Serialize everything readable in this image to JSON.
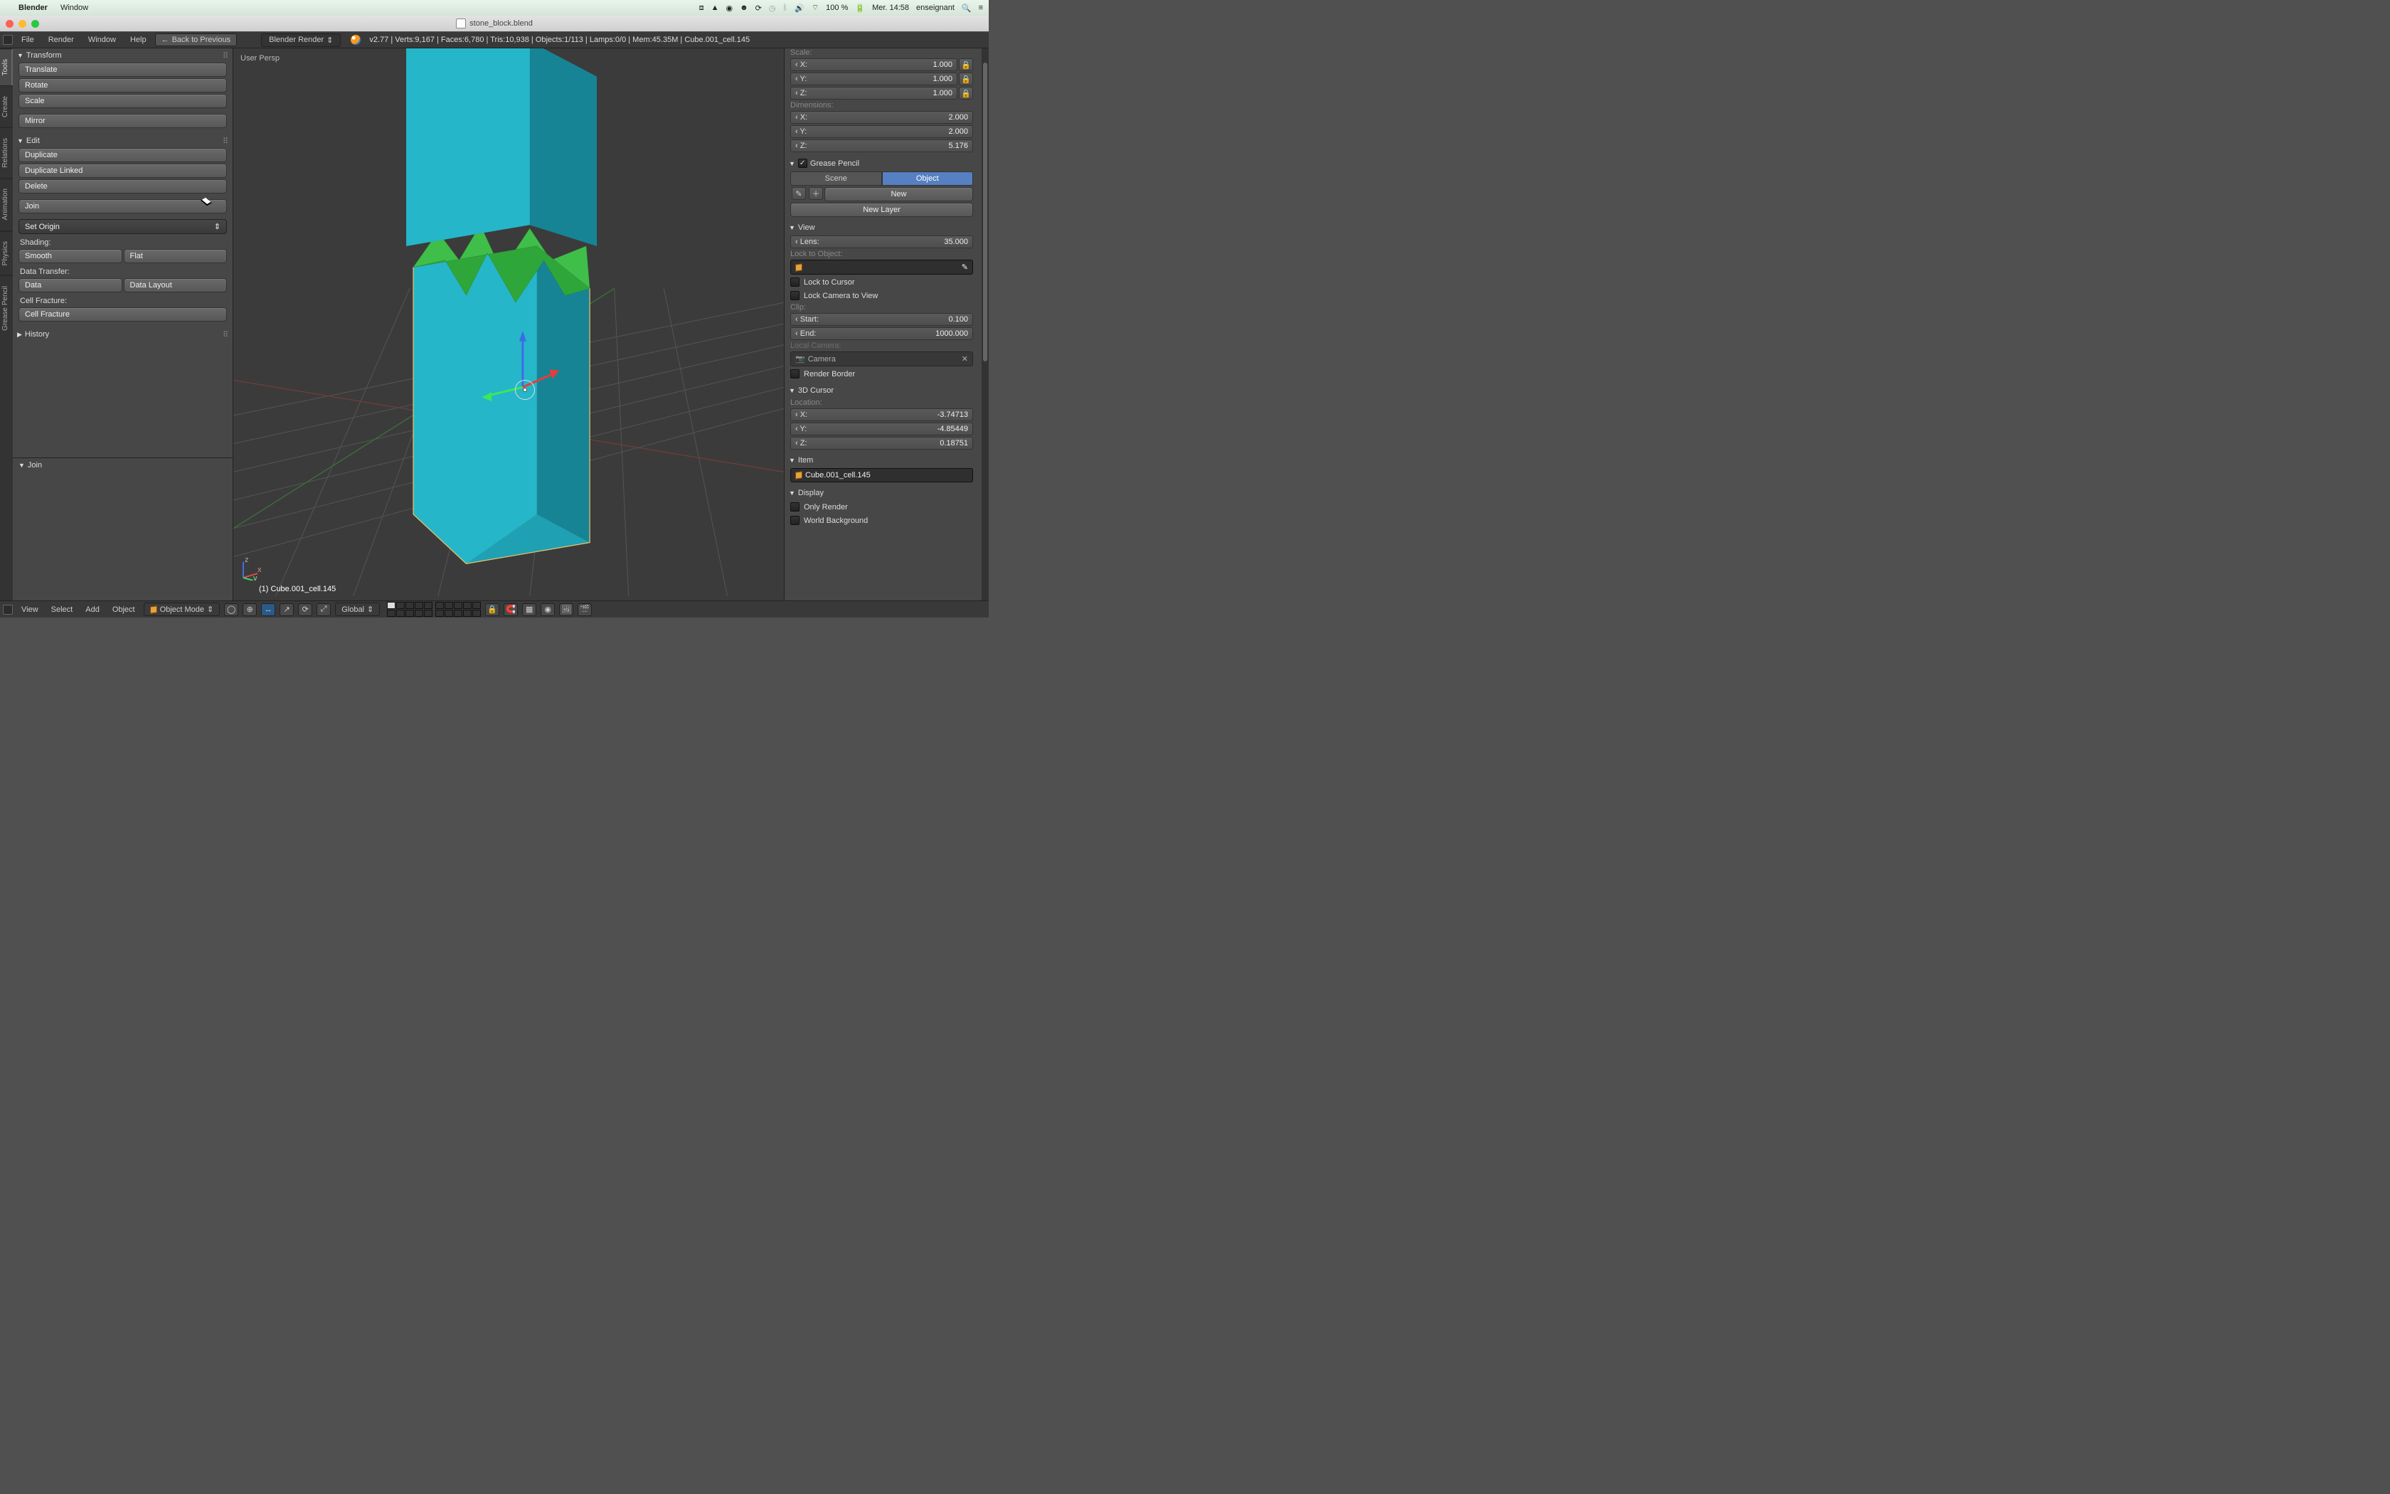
{
  "macos": {
    "app": "Blender",
    "menu_window": "Window",
    "battery": "100 %",
    "day_time": "Mer. 14:58",
    "user": "enseignant"
  },
  "window": {
    "title": "stone_block.blend"
  },
  "info": {
    "menus": {
      "file": "File",
      "render": "Render",
      "window": "Window",
      "help": "Help"
    },
    "back": "Back to Previous",
    "renderer": "Blender Render",
    "version": "v2.77",
    "stats": "Verts:9,167 | Faces:6,780 | Tris:10,938 | Objects:1/113 | Lamps:0/0 | Mem:45.35M | Cube.001_cell.145"
  },
  "vtabs": [
    "Tools",
    "Create",
    "Relations",
    "Animation",
    "Physics",
    "Grease Pencil"
  ],
  "toolshelf": {
    "transform": {
      "title": "Transform",
      "translate": "Translate",
      "rotate": "Rotate",
      "scale": "Scale",
      "mirror": "Mirror"
    },
    "edit": {
      "title": "Edit",
      "duplicate": "Duplicate",
      "duplicate_linked": "Duplicate Linked",
      "delete": "Delete",
      "join": "Join",
      "set_origin": "Set Origin"
    },
    "shading_label": "Shading:",
    "shading": {
      "smooth": "Smooth",
      "flat": "Flat"
    },
    "data_transfer_label": "Data Transfer:",
    "data_transfer": {
      "data": "Data",
      "layout": "Data Layout"
    },
    "cell_label": "Cell Fracture:",
    "cell_btn": "Cell Fracture",
    "history": "History"
  },
  "op_panel": "Join",
  "viewport": {
    "persp": "User Persp",
    "object_label": "(1) Cube.001_cell.145"
  },
  "nprops": {
    "scale_label": "Scale:",
    "scale": {
      "x": "1.000",
      "y": "1.000",
      "z": "1.000"
    },
    "dims_label": "Dimensions:",
    "dims": {
      "x": "2.000",
      "y": "2.000",
      "z": "5.176"
    },
    "gp": {
      "title": "Grease Pencil",
      "scene": "Scene",
      "object": "Object",
      "new": "New",
      "new_layer": "New Layer"
    },
    "view": {
      "title": "View",
      "lens_label": "Lens:",
      "lens": "35.000",
      "lock_obj": "Lock to Object:",
      "lock_cursor": "Lock to Cursor",
      "lock_cam": "Lock Camera to View",
      "clip": "Clip:",
      "start_l": "Start:",
      "start": "0.100",
      "end_l": "End:",
      "end": "1000.000",
      "local_cam": "Local Camera:",
      "camera": "Camera",
      "render_border": "Render Border"
    },
    "cursor3d": {
      "title": "3D Cursor",
      "loc": "Location:",
      "x": "-3.74713",
      "y": "-4.85449",
      "z": "0.18751"
    },
    "item": {
      "title": "Item",
      "name": "Cube.001_cell.145"
    },
    "display": {
      "title": "Display",
      "only_render": "Only Render",
      "world_bg": "World Background"
    }
  },
  "view3d_header": {
    "view": "View",
    "select": "Select",
    "add": "Add",
    "object": "Object",
    "mode": "Object Mode",
    "orient": "Global"
  }
}
